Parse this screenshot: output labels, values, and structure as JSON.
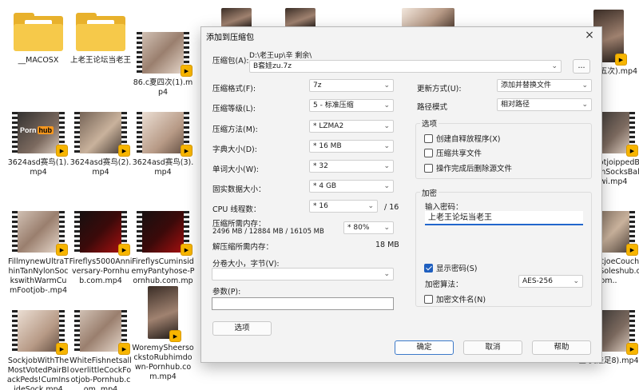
{
  "explorer": {
    "files": [
      {
        "name": "__MACOSX",
        "kind": "folder"
      },
      {
        "name": "上老王论坛当老王",
        "kind": "folder"
      },
      {
        "name": "86.c夏四次(1).mp4",
        "kind": "video"
      },
      {
        "name": "3624asd赛鸟(1).mp4",
        "kind": "video"
      },
      {
        "name": "3624asd赛鸟(2).mp4",
        "kind": "video"
      },
      {
        "name": "3624asd赛鸟(3).mp4",
        "kind": "video"
      },
      {
        "name": "FillmynewUltraThinTanNylonSockswithWarmCumFootjob-.mp4",
        "kind": "video"
      },
      {
        "name": "Fireflys5000Anniversary-Pornhub.com.mp4",
        "kind": "video"
      },
      {
        "name": "FireflysCuminsidemyPantyhose-Pornhub.com.mp4",
        "kind": "video"
      },
      {
        "name": "SockjobWithTheMostVotedPairBlackPeds!CumInsideSock.mp4",
        "kind": "video"
      },
      {
        "name": "WhiteFishnetsalloverlittleCockFootjob-Pornhub.com..mp4",
        "kind": "video"
      },
      {
        "name": "WoremySheersockstoRubhimdown-Pornhub.com.mp4",
        "kind": "video"
      },
      {
        "name": "0分钟五次).mp4",
        "kind": "video"
      },
      {
        "name": "eurFootjoippedBlacotonSocksBalngwi.mp4",
        "kind": "video"
      },
      {
        "name": "obFootjoeCouchCotonSoleshub.com..",
        "kind": "video"
      },
      {
        "name": "金 赛娃足8).mp4",
        "kind": "video"
      }
    ],
    "ph_logo_a": "Porn",
    "ph_logo_b": "hub",
    "badge": "Player"
  },
  "dialog": {
    "title": "添加到压缩包",
    "close": "×",
    "archive_label": "压缩包(A):",
    "archive_dir": "D:\\老王up\\辛 剩余\\",
    "archive_name": "B套娃zu.7z",
    "browse": "...",
    "format_label": "压缩格式(F):",
    "format_value": "7z",
    "level_label": "压缩等级(L):",
    "level_value": "5 - 标准压缩",
    "method_label": "压缩方法(M):",
    "method_value": "* LZMA2",
    "dict_label": "字典大小(D):",
    "dict_value": "* 16 MB",
    "word_label": "单词大小(W):",
    "word_value": "* 32",
    "solid_label": "固实数据大小：",
    "solid_value": "* 4 GB",
    "cpu_label": "CPU 线程数：",
    "cpu_value": "* 16",
    "cpu_max": "/ 16",
    "mem_label": "压缩所需内存：",
    "mem_value": "2496 MB / 12884 MB / 16105 MB",
    "mem_pct": "* 80%",
    "decomp_label": "解压缩所需内存：",
    "decomp_value": "18 MB",
    "split_label": "分卷大小，字节(V):",
    "split_value": "",
    "params_label": "参数(P):",
    "params_value": "",
    "options_btn": "选项",
    "update_label": "更新方式(U):",
    "update_value": "添加并替换文件",
    "path_label": "路径模式",
    "path_value": "相对路径",
    "options_group": "选项",
    "opt_sfx": "创建自释放程序(X)",
    "opt_shared": "压缩共享文件",
    "opt_delete": "操作完成后删除源文件",
    "enc_group": "加密",
    "pwd_label": "输入密码：",
    "pwd_value": "上老王论坛当老王",
    "show_pwd": "显示密码(S)",
    "enc_method_label": "加密算法：",
    "enc_method_value": "AES-256",
    "enc_names": "加密文件名(N)",
    "ok": "确定",
    "cancel": "取消",
    "help": "帮助"
  }
}
